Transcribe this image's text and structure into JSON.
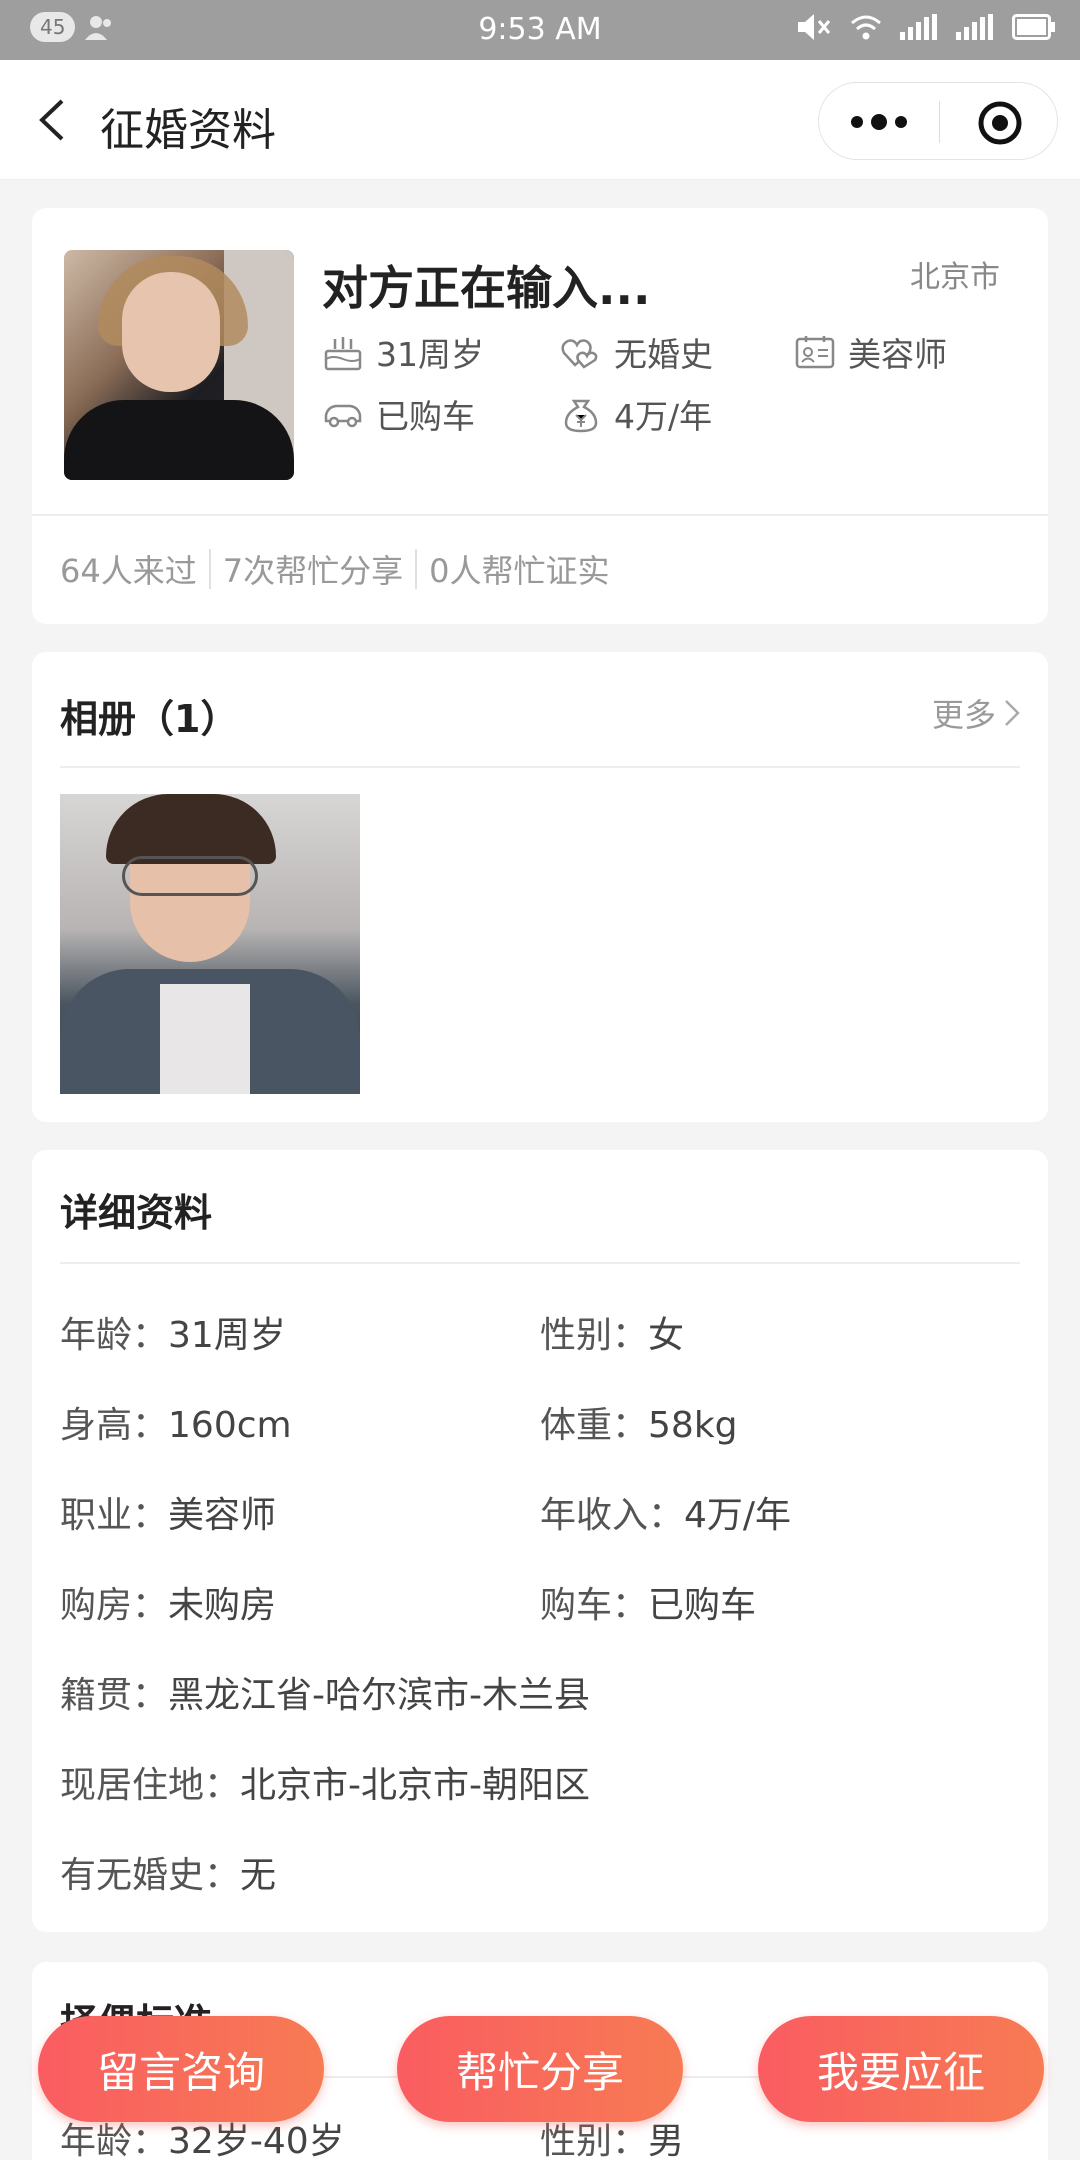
{
  "status_bar": {
    "badge": "45",
    "time": "9:53 AM",
    "battery_level": 0.8
  },
  "nav": {
    "title": "征婚资料"
  },
  "profile": {
    "name": "对方正在输入...",
    "city": "北京市",
    "tags": {
      "age": "31周岁",
      "marriage": "无婚史",
      "job": "美容师",
      "car": "已购车",
      "income": "4万/年"
    },
    "stats": {
      "visitors": "64人来过",
      "shares": "7次帮忙分享",
      "verified": "0人帮忙证实"
    }
  },
  "album": {
    "title": "相册（1）",
    "more": "更多"
  },
  "details": {
    "title": "详细资料",
    "fields": [
      {
        "label": "年龄：",
        "value": "31周岁"
      },
      {
        "label": "性别：",
        "value": "女"
      },
      {
        "label": "身高：",
        "value": "160cm"
      },
      {
        "label": "体重：",
        "value": "58kg"
      },
      {
        "label": "职业：",
        "value": "美容师"
      },
      {
        "label": "年收入：",
        "value": "4万/年"
      },
      {
        "label": "购房：",
        "value": "未购房"
      },
      {
        "label": "购车：",
        "value": "已购车"
      },
      {
        "label": "籍贯：",
        "value": "黑龙江省-哈尔滨市-木兰县"
      },
      {
        "label": "现居住地：",
        "value": "北京市-北京市-朝阳区"
      },
      {
        "label": "有无婚史：",
        "value": "无"
      }
    ]
  },
  "criteria": {
    "title": "择偶标准",
    "fields": [
      {
        "label": "年龄：",
        "value": "32岁-40岁"
      },
      {
        "label": "性别：",
        "value": "男"
      }
    ]
  },
  "actions": {
    "consult": "留言咨询",
    "share": "帮忙分享",
    "apply": "我要应征"
  },
  "colors": {
    "accent_start": "#fa5c61",
    "accent_end": "#f77b53",
    "status_bar": "#9e9e9e",
    "page_bg": "#f4f4f4"
  }
}
